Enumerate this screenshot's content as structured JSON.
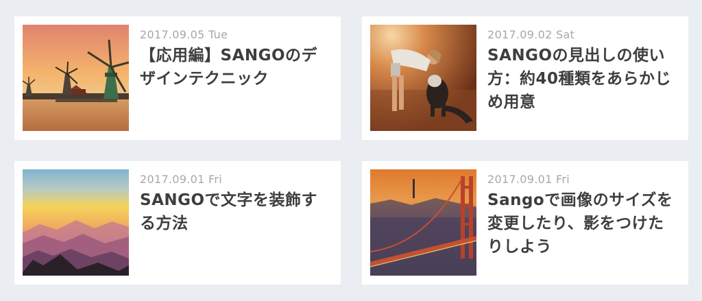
{
  "posts": [
    {
      "date": "2017.09.05 Tue",
      "title": "【応用編】SANGOのデザインテクニック",
      "thumbnail": "windmills-sunset-image"
    },
    {
      "date": "2017.09.02 Sat",
      "title": "SANGOの見出しの使い方：約40種類をあらかじめ用意",
      "thumbnail": "woman-with-dog-image"
    },
    {
      "date": "2017.09.01 Fri",
      "title": "SANGOで文字を装飾する方法",
      "thumbnail": "mountain-sunset-image"
    },
    {
      "date": "2017.09.01 Fri",
      "title": "Sangoで画像のサイズを変更したり、影をつけたりしよう",
      "thumbnail": "golden-gate-bridge-image"
    }
  ],
  "colors": {
    "background": "#eaedf2",
    "card": "#ffffff",
    "date": "#a7a7a7",
    "title": "#3e3e3e"
  }
}
